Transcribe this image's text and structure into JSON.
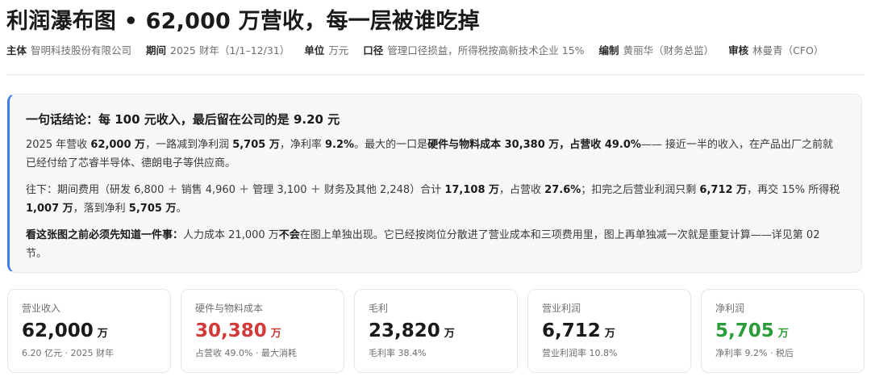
{
  "title": "利润瀑布图 • 62,000 万营收，每一层被谁吃掉",
  "meta": [
    {
      "key": "主体",
      "value": "智明科技股份有限公司"
    },
    {
      "key": "期间",
      "value": "2025 财年（1/1–12/31）"
    },
    {
      "key": "单位",
      "value": "万元"
    },
    {
      "key": "口径",
      "value": "管理口径损益，所得税按高新技术企业 15%"
    },
    {
      "key": "编制",
      "value": "黄丽华（财务总监）"
    },
    {
      "key": "审核",
      "value": "林曼青（CFO）"
    }
  ],
  "summary": {
    "heading": "一句话结论：每 100 元收入，最后留在公司的是 9.20 元",
    "p1": [
      {
        "t": "2025 年营收 ",
        "b": false
      },
      {
        "t": "62,000 万",
        "b": true
      },
      {
        "t": "，一路减到净利润 ",
        "b": false
      },
      {
        "t": "5,705 万",
        "b": true
      },
      {
        "t": "，净利率 ",
        "b": false
      },
      {
        "t": "9.2%",
        "b": true
      },
      {
        "t": "。最大的一口是",
        "b": false
      },
      {
        "t": "硬件与物料成本 30,380 万，占营收 49.0%",
        "b": true
      },
      {
        "t": "—— 接近一半的收入，在产品出厂之前就已经付给了芯睿半导体、德朗电子等供应商。",
        "b": false
      }
    ],
    "p2": [
      {
        "t": "往下：期间费用（研发 6,800 ＋ 销售 4,960 ＋ 管理 3,100 ＋ 财务及其他 2,248）合计 ",
        "b": false
      },
      {
        "t": "17,108 万",
        "b": true
      },
      {
        "t": "，占营收 ",
        "b": false
      },
      {
        "t": "27.6%",
        "b": true
      },
      {
        "t": "；扣完之后营业利润只剩 ",
        "b": false
      },
      {
        "t": "6,712 万",
        "b": true
      },
      {
        "t": "，再交 15% 所得税 ",
        "b": false
      },
      {
        "t": "1,007 万",
        "b": true
      },
      {
        "t": "，落到净利 ",
        "b": false
      },
      {
        "t": "5,705 万",
        "b": true
      },
      {
        "t": "。",
        "b": false
      }
    ],
    "p3": [
      {
        "t": "看这张图之前必须先知道一件事：",
        "b": true
      },
      {
        "t": "人力成本 21,000 万",
        "b": false
      },
      {
        "t": "不会",
        "b": true
      },
      {
        "t": "在图上单独出现。它已经按岗位分散进了营业成本和三项费用里，图上再单独减一次就是重复计算——详见第 02 节。",
        "b": false
      }
    ]
  },
  "cards": [
    {
      "label": "营业收入",
      "value": "62,000",
      "unit": "万",
      "sub": "6.20 亿元 · 2025 财年",
      "color": "#1a1a1a"
    },
    {
      "label": "硬件与物料成本",
      "value": "30,380",
      "unit": "万",
      "sub": "占营收 49.0% · 最大消耗",
      "color": "#d23a3a"
    },
    {
      "label": "毛利",
      "value": "23,820",
      "unit": "万",
      "sub": "毛利率 38.4%",
      "color": "#1a1a1a"
    },
    {
      "label": "营业利润",
      "value": "6,712",
      "unit": "万",
      "sub": "营业利润率 10.8%",
      "color": "#1a1a1a"
    },
    {
      "label": "净利润",
      "value": "5,705",
      "unit": "万",
      "sub": "净利率 9.2% · 税后",
      "color": "#2a9d3a"
    }
  ]
}
